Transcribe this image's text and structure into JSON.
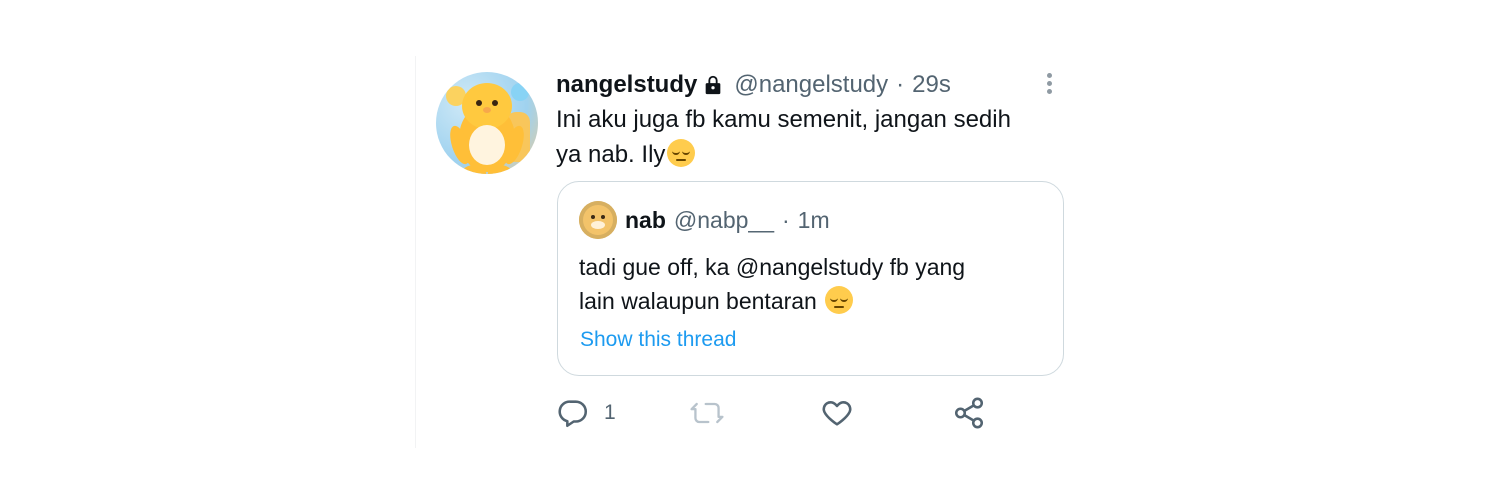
{
  "tweet": {
    "name": "nangelstudy",
    "handle": "@nangelstudy",
    "separator": "·",
    "time": "29s",
    "text_line_1": "Ini aku juga fb kamu semenit, jangan sedih",
    "text_line_2": "ya nab. Ily",
    "emoji_name": "face-with-rolling-eyes-icon"
  },
  "quote": {
    "name": "nab",
    "handle": "@nabp__",
    "separator": "·",
    "time": "1m",
    "text_line_1": "tadi gue off, ka @nangelstudy fb yang",
    "text_line_2": "lain walaupun bentaran",
    "emoji_name": "pensive-face-icon",
    "thread_link": "Show this thread"
  },
  "actions": {
    "reply_count": "1",
    "icons": [
      "reply-icon",
      "retweet-icon",
      "like-icon",
      "share-icon"
    ]
  },
  "colors": {
    "link": "#1d9bf0",
    "text": "#0f1419",
    "muted": "#536471",
    "border": "#cfd9de",
    "emoji": "#ffcc4d"
  }
}
